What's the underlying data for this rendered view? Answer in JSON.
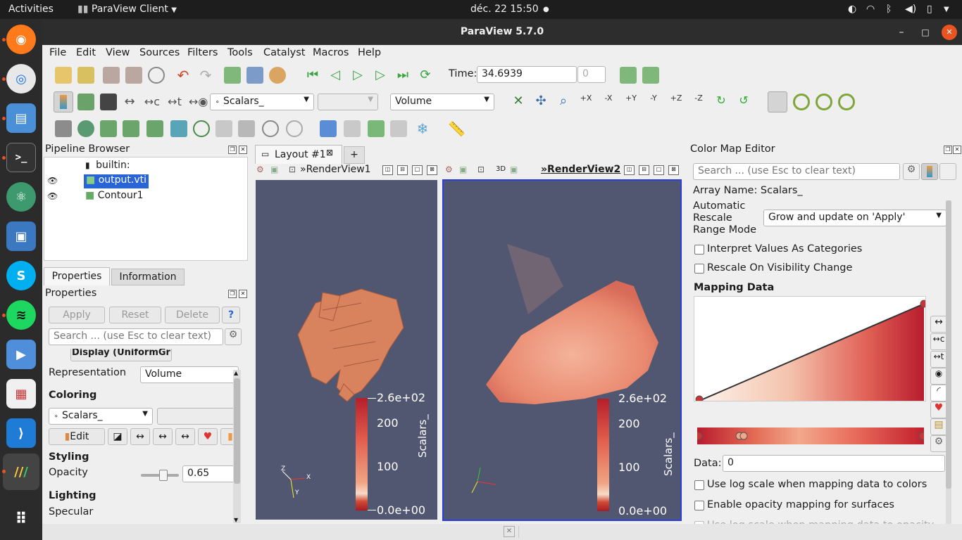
{
  "topbar": {
    "activities": "Activities",
    "app": "ParaView Client",
    "clock": "déc. 22  15:50"
  },
  "dock": {
    "items": [
      "firefox",
      "chrome",
      "files",
      "terminal",
      "atom",
      "screenshot",
      "skype",
      "spotify",
      "kdenlive",
      "document-viewer",
      "vscode",
      "paraview",
      "app-grid"
    ]
  },
  "window": {
    "title": "ParaView 5.7.0",
    "minimize": "–",
    "maximize": "□",
    "close": "✕"
  },
  "menu": {
    "file": "File",
    "edit": "Edit",
    "view": "View",
    "sources": "Sources",
    "filters": "Filters",
    "tools": "Tools",
    "catalyst": "Catalyst",
    "macros": "Macros",
    "help": "Help"
  },
  "time": {
    "label": "Time:",
    "value": "34.6939",
    "step": "0"
  },
  "toolbar2": {
    "array": "Scalars_",
    "component": "",
    "representation": "Volume"
  },
  "pipeline": {
    "title": "Pipeline Browser",
    "items": [
      {
        "label": "builtin:"
      },
      {
        "label": "output.vti"
      },
      {
        "label": "Contour1"
      }
    ]
  },
  "props": {
    "tab_properties": "Properties",
    "tab_information": "Information",
    "title": "Properties",
    "apply": "Apply",
    "reset": "Reset",
    "delete": "Delete",
    "help": "?",
    "search_placeholder": "Search ... (use Esc to clear text)",
    "display_cut": "Display (UniformGr",
    "representation_label": "Representation",
    "representation_value": "Volume",
    "coloring": "Coloring",
    "color_array": "Scalars_",
    "edit": "Edit",
    "styling": "Styling",
    "opacity_label": "Opacity",
    "opacity_value": "0.65",
    "lighting": "Lighting",
    "specular_cut": "Specular"
  },
  "layout": {
    "tab": "Layout #1",
    "add": "+",
    "view1": "RenderView1",
    "view2": "RenderView2",
    "mode3d": "3D"
  },
  "views": {
    "cb_max": "2.6e+02",
    "cb_200": "200",
    "cb_100": "100",
    "cb_min": "0.0e+00",
    "cb_title": "Scalars_",
    "axis_x": "X",
    "axis_y": "Y",
    "axis_z": "Z"
  },
  "cme": {
    "title": "Color Map Editor",
    "search_placeholder": "Search ... (use Esc to clear text)",
    "array_name": "Array Name: Scalars_",
    "auto_rescale_1": "Automatic",
    "auto_rescale_2": "Rescale",
    "auto_rescale_3": "Range Mode",
    "auto_rescale_value": "Grow and update on 'Apply'",
    "interpret": "Interpret Values As Categories",
    "rescale_vis": "Rescale On Visibility Change",
    "mapping": "Mapping Data",
    "data_label": "Data:",
    "data_value": "0",
    "log_colors": "Use log scale when mapping data to colors",
    "opacity_surfaces": "Enable opacity mapping for surfaces",
    "log_opacity": "Use log scale when mapping data to opacity"
  },
  "colors": {
    "accent": "#2965d6",
    "view_bg": "#525771",
    "title_bg": "#2d2d2d",
    "close_red": "#e95420"
  }
}
